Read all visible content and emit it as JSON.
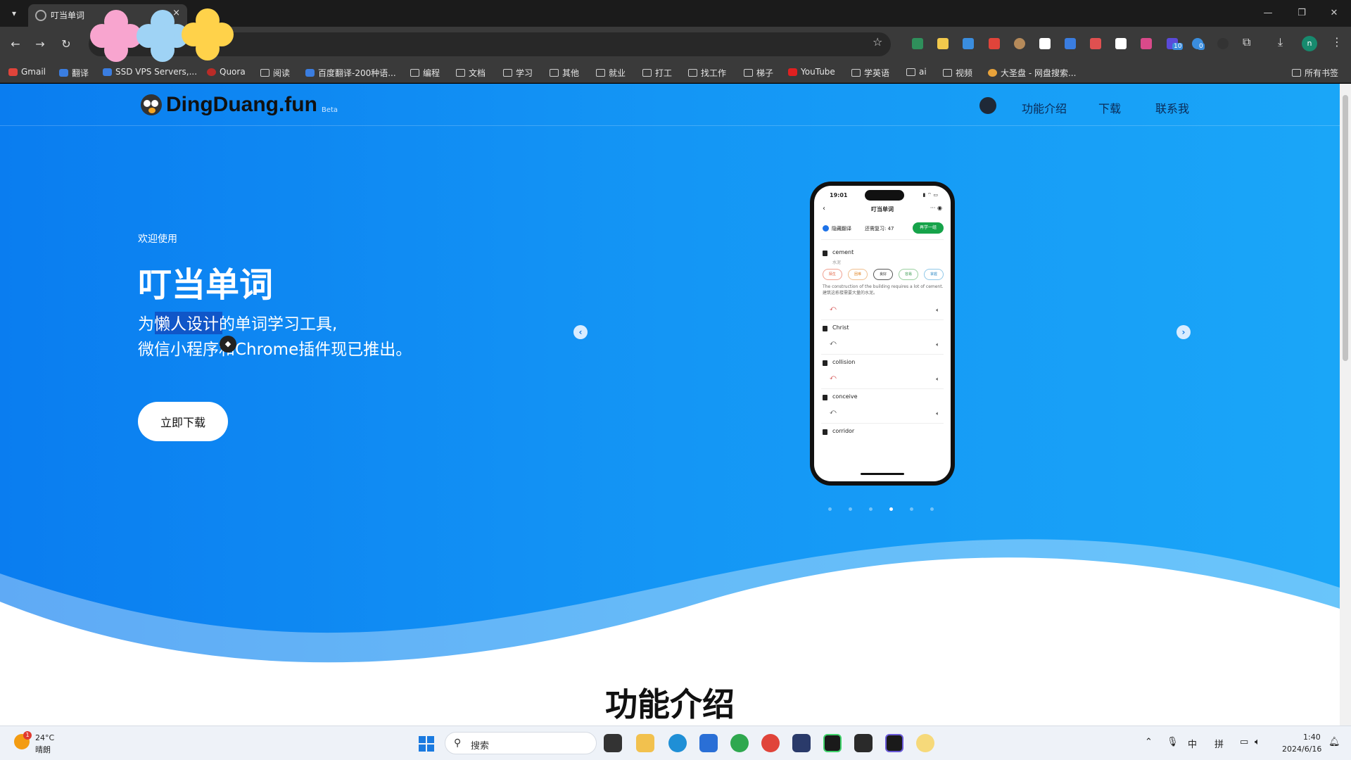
{
  "browser": {
    "tab_title": "叮当单词",
    "tab_close": "×",
    "bookmarks": [
      "Gmail",
      "翻译",
      "SSD VPS Servers,...",
      "Quora",
      "阅读",
      "百度翻译-200种语...",
      "编程",
      "文档",
      "学习",
      "其他",
      "就业",
      "打工",
      "找工作",
      "梯子",
      "YouTube",
      "学英语",
      "ai",
      "视频",
      "大圣盘 - 网盘搜索..."
    ],
    "all_bookmarks": "所有书签",
    "profile_initial": "n",
    "ext_badge_1": "10",
    "ext_badge_2": "0"
  },
  "site": {
    "logo": "DingDuang.fun",
    "beta": "Beta",
    "nav": [
      "功能介绍",
      "下载",
      "联系我"
    ]
  },
  "hero": {
    "welcome": "欢迎使用",
    "title": "叮当单词",
    "tagline_1": "为懒人设计的单词学习工具,",
    "tagline_2": "微信小程序和Chrome插件现已推出。",
    "cta": "立即下载",
    "active_slide": 4,
    "slide_count": 6
  },
  "phone": {
    "time": "19:01",
    "title": "叮当单词",
    "hide_translation": "隐藏翻译",
    "review_count": "还需复习: 47",
    "learn_button": "再学一组",
    "words": [
      "cement",
      "Christ",
      "collision",
      "conceive",
      "corridor"
    ],
    "cement_meaning": "水泥",
    "ratings": [
      "陌生",
      "困难",
      "良好",
      "容易",
      "掌握"
    ],
    "sentence_en": "The construction of the building requires a lot of cement.",
    "sentence_zh": "建筑这栋楼需要大量的水泥。"
  },
  "section": {
    "title": "功能介绍"
  },
  "taskbar": {
    "temperature": "24°C",
    "condition": "晴朗",
    "weather_badge": "1",
    "search": "搜索",
    "ime_1": "中",
    "ime_2": "拼",
    "time": "1:40",
    "date": "2024/6/16"
  },
  "colors": {
    "hero_start": "#0a7df0",
    "hero_end": "#1aa6f8",
    "learn_green": "#16a34a"
  }
}
